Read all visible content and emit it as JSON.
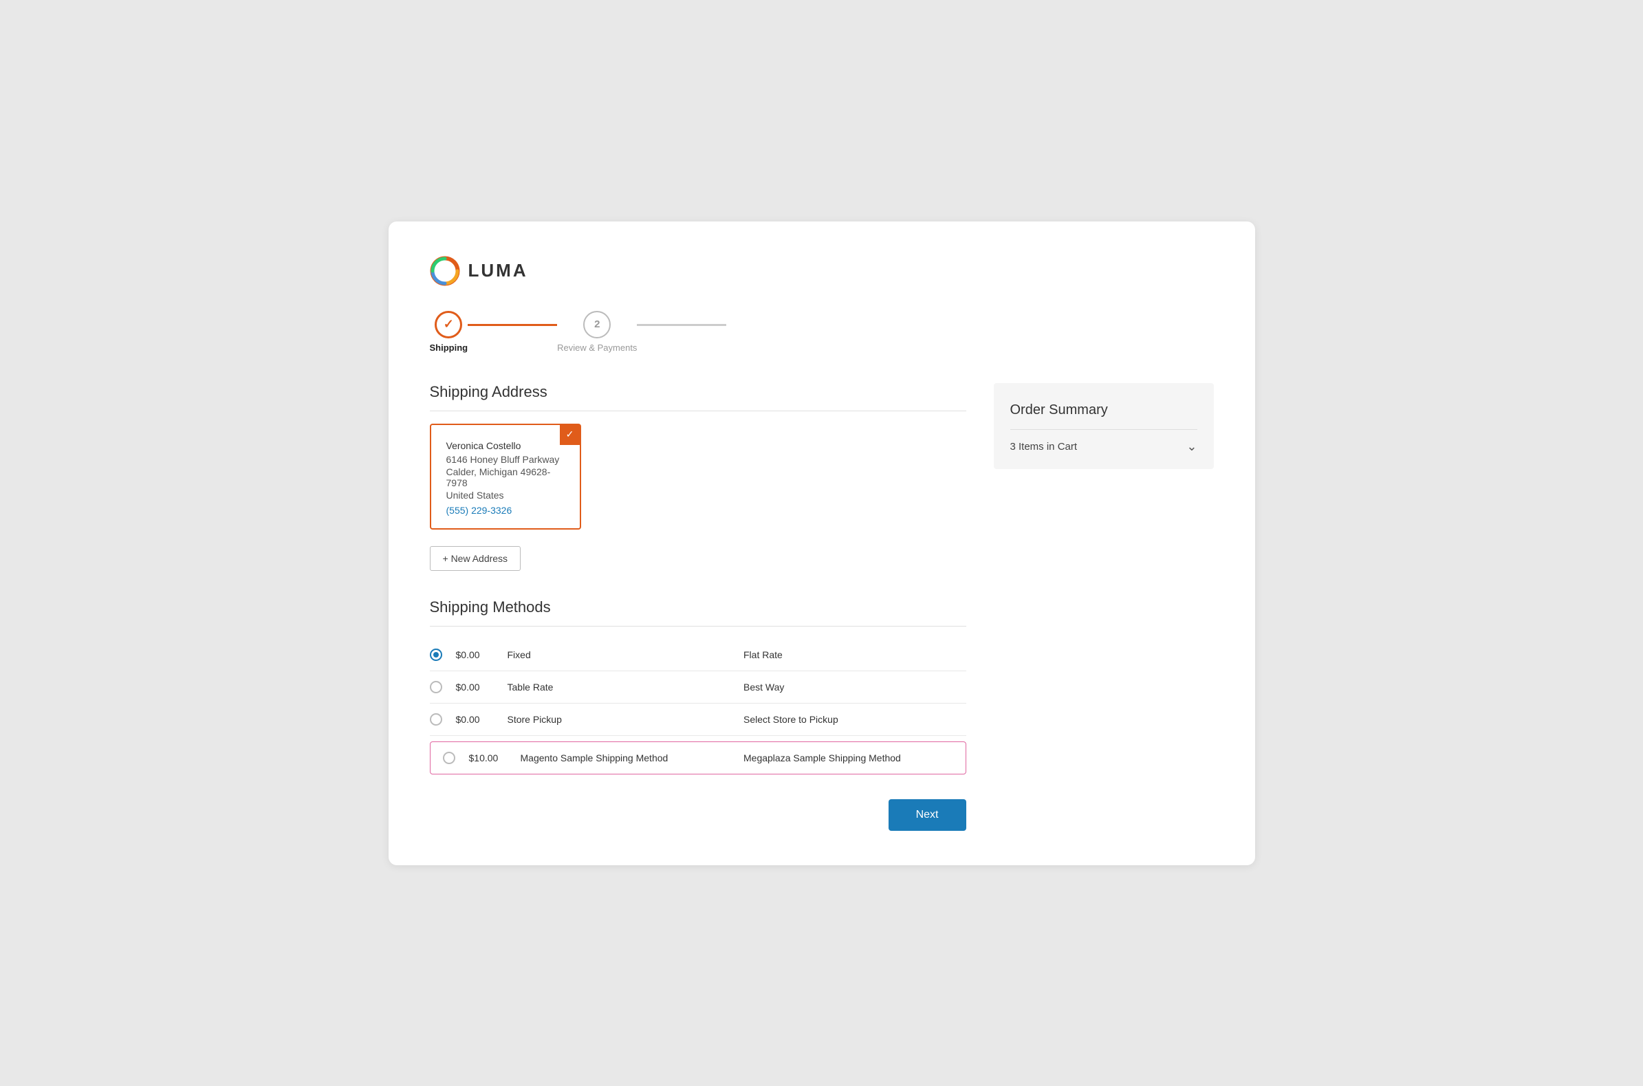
{
  "logo": {
    "text": "LUMA"
  },
  "progress": {
    "step1": {
      "label": "Shipping",
      "state": "active"
    },
    "step2": {
      "number": "2",
      "label": "Review & Payments",
      "state": "inactive"
    }
  },
  "shipping_address": {
    "section_title": "Shipping Address",
    "selected_address": {
      "name": "Veronica Costello",
      "street": "6146 Honey Bluff Parkway",
      "city_state_zip": "Calder, Michigan 49628-7978",
      "country": "United States",
      "phone": "(555) 229-3326"
    },
    "new_address_button": "+ New Address"
  },
  "shipping_methods": {
    "section_title": "Shipping Methods",
    "methods": [
      {
        "price": "$0.00",
        "name": "Fixed",
        "carrier": "Flat Rate",
        "selected": true,
        "highlighted": false
      },
      {
        "price": "$0.00",
        "name": "Table Rate",
        "carrier": "Best Way",
        "selected": false,
        "highlighted": false
      },
      {
        "price": "$0.00",
        "name": "Store Pickup",
        "carrier": "Select Store to Pickup",
        "selected": false,
        "highlighted": false
      },
      {
        "price": "$10.00",
        "name": "Magento Sample Shipping Method",
        "carrier": "Megaplaza Sample Shipping Method",
        "selected": false,
        "highlighted": true
      }
    ]
  },
  "next_button": "Next",
  "order_summary": {
    "title": "Order Summary",
    "items_in_cart": "3 Items in Cart"
  }
}
